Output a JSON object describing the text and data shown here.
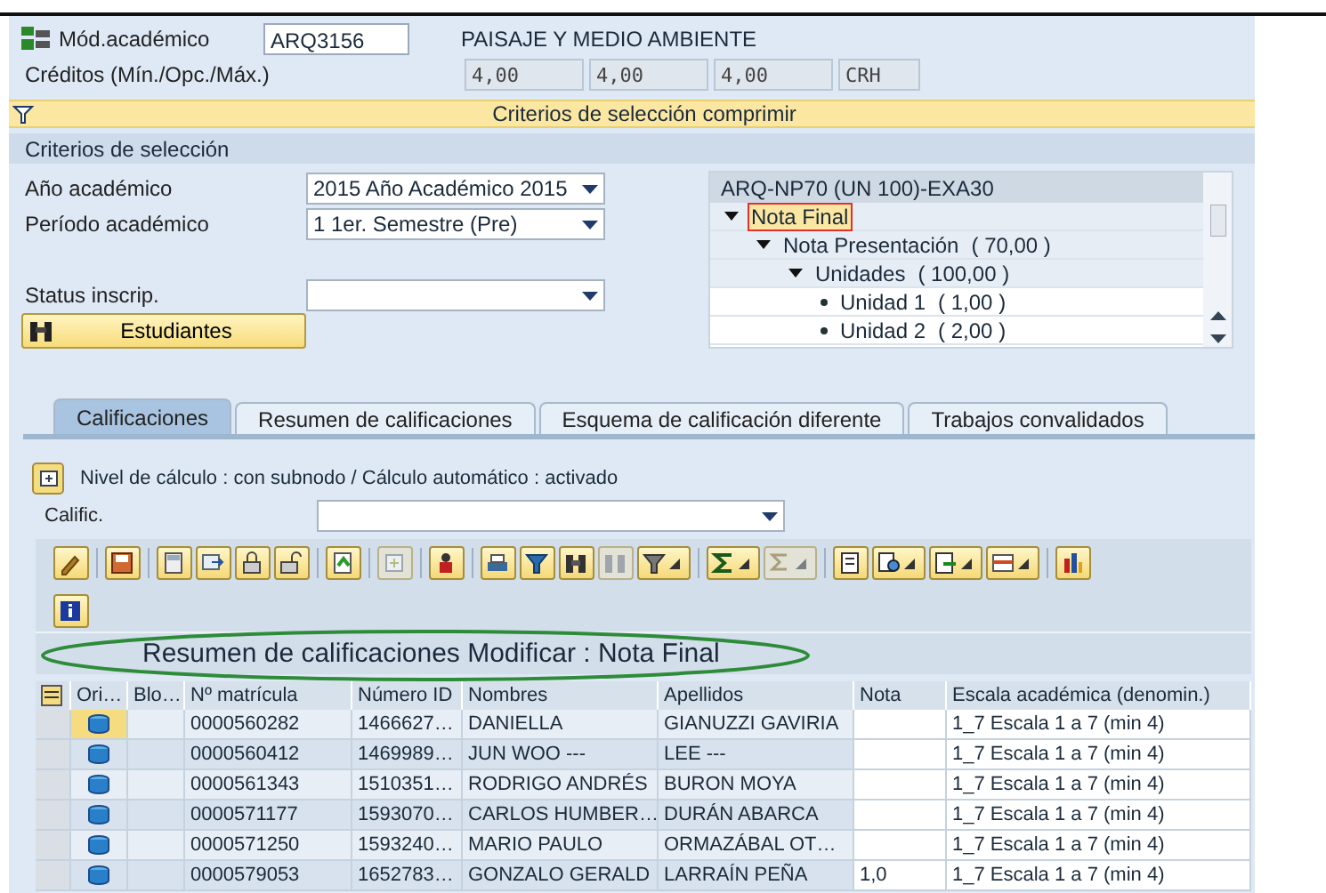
{
  "header": {
    "module_label": "Mód.académico",
    "module_value": "ARQ3156",
    "module_name": "PAISAJE Y MEDIO AMBIENTE",
    "credits_label": "Créditos (Mín./Opc./Máx.)",
    "credits": [
      "4,00",
      "4,00",
      "4,00",
      "CRH"
    ]
  },
  "collapse_bar": {
    "label": "Criterios de selección comprimir"
  },
  "selection": {
    "title": "Criterios de selección",
    "fields": [
      {
        "label": "Año académico",
        "value": "2015 Año Académico 2015"
      },
      {
        "label": "Período académico",
        "value": "1 1er. Semestre (Pre)"
      },
      {
        "label": "Status inscrip."
      }
    ],
    "button": "Estudiantes"
  },
  "tree": {
    "title": "ARQ-NP70 (UN 100)-EXA30",
    "nodes": [
      {
        "label": "Nota Final",
        "selected": true,
        "expanded": true,
        "children": [
          {
            "label": "Nota Presentación",
            "value": "( 70,00 )",
            "selected": false,
            "expanded": true,
            "children": [
              {
                "label": "Unidades",
                "value": "( 100,00 )",
                "selected": false,
                "expanded": true,
                "children": [
                  {
                    "label": "Unidad 1",
                    "value": "(   1,00 )",
                    "selected": false
                  },
                  {
                    "label": "Unidad 2",
                    "value": "(   2,00 )",
                    "selected": false
                  }
                ]
              }
            ]
          }
        ]
      }
    ]
  },
  "tabs": [
    {
      "label": "Calificaciones",
      "selected": true
    },
    {
      "label": "Resumen de calificaciones",
      "selected": false
    },
    {
      "label": "Esquema de calificación diferente",
      "selected": false
    },
    {
      "label": "Trabajos convalidados",
      "selected": false
    }
  ],
  "calc_info": "Nivel de cálculo : con subnodo / Cálculo automático : activado",
  "grade_field": {
    "label": "Calific."
  },
  "toolbar": [
    [
      {
        "disabled": false,
        "dropdown": false
      }
    ],
    [
      {
        "disabled": false,
        "dropdown": false
      }
    ],
    [
      {
        "disabled": false,
        "dropdown": false
      },
      {
        "disabled": false,
        "dropdown": false
      },
      {
        "disabled": false,
        "dropdown": false
      },
      {
        "disabled": false,
        "dropdown": false
      }
    ],
    [
      {
        "disabled": false,
        "dropdown": false
      }
    ],
    [
      {
        "disabled": true,
        "dropdown": false
      }
    ],
    [
      {
        "disabled": false,
        "dropdown": false
      }
    ],
    [
      {
        "disabled": false,
        "dropdown": false
      },
      {
        "disabled": false,
        "dropdown": false
      },
      {
        "disabled": false,
        "dropdown": false
      },
      {
        "disabled": true,
        "dropdown": false
      },
      {
        "disabled": false,
        "dropdown": true
      }
    ],
    [
      {
        "disabled": false,
        "dropdown": true
      },
      {
        "disabled": true,
        "dropdown": true
      }
    ],
    [
      {
        "disabled": false,
        "dropdown": false
      },
      {
        "disabled": false,
        "dropdown": true
      },
      {
        "disabled": false,
        "dropdown": true
      },
      {
        "disabled": false,
        "dropdown": true
      }
    ],
    [
      {
        "disabled": false,
        "dropdown": false
      }
    ],
    [
      {
        "disabled": false,
        "dropdown": false
      }
    ]
  ],
  "grid_title": "Resumen de calificaciones Modificar : Nota Final",
  "table": {
    "columns": [
      "Ori…",
      "Blo…",
      "Nº matrícula",
      "Número ID",
      "Nombres",
      "Apellidos",
      "Nota",
      "Escala académica (denomin.)"
    ],
    "rows": [
      {
        "focused": true,
        "cells": [
          "",
          "",
          "0000560282",
          "1466627…",
          "DANIELLA",
          "GIANUZZI GAVIRIA",
          "",
          "1_7 Escala 1 a 7 (min 4)"
        ]
      },
      {
        "focused": false,
        "cells": [
          "",
          "",
          "0000560412",
          "1469989…",
          "JUN WOO ---",
          "LEE ---",
          "",
          "1_7 Escala 1 a 7 (min 4)"
        ]
      },
      {
        "focused": false,
        "cells": [
          "",
          "",
          "0000561343",
          "1510351…",
          "RODRIGO ANDRÉS",
          "BURON MOYA",
          "",
          "1_7 Escala 1 a 7 (min 4)"
        ]
      },
      {
        "focused": false,
        "cells": [
          "",
          "",
          "0000571177",
          "1593070…",
          "CARLOS HUMBER…",
          "DURÁN ABARCA",
          "",
          "1_7 Escala 1 a 7 (min 4)"
        ]
      },
      {
        "focused": false,
        "cells": [
          "",
          "",
          "0000571250",
          "1593240…",
          "MARIO PAULO",
          "ORMAZÁBAL OT…",
          "",
          "1_7 Escala 1 a 7 (min 4)"
        ]
      },
      {
        "focused": false,
        "cells": [
          "",
          "",
          "0000579053",
          "1652783…",
          "GONZALO GERALD",
          "LARRAÍN PEÑA",
          "1,0",
          "1_7 Escala 1 a 7 (min 4)"
        ]
      }
    ]
  }
}
